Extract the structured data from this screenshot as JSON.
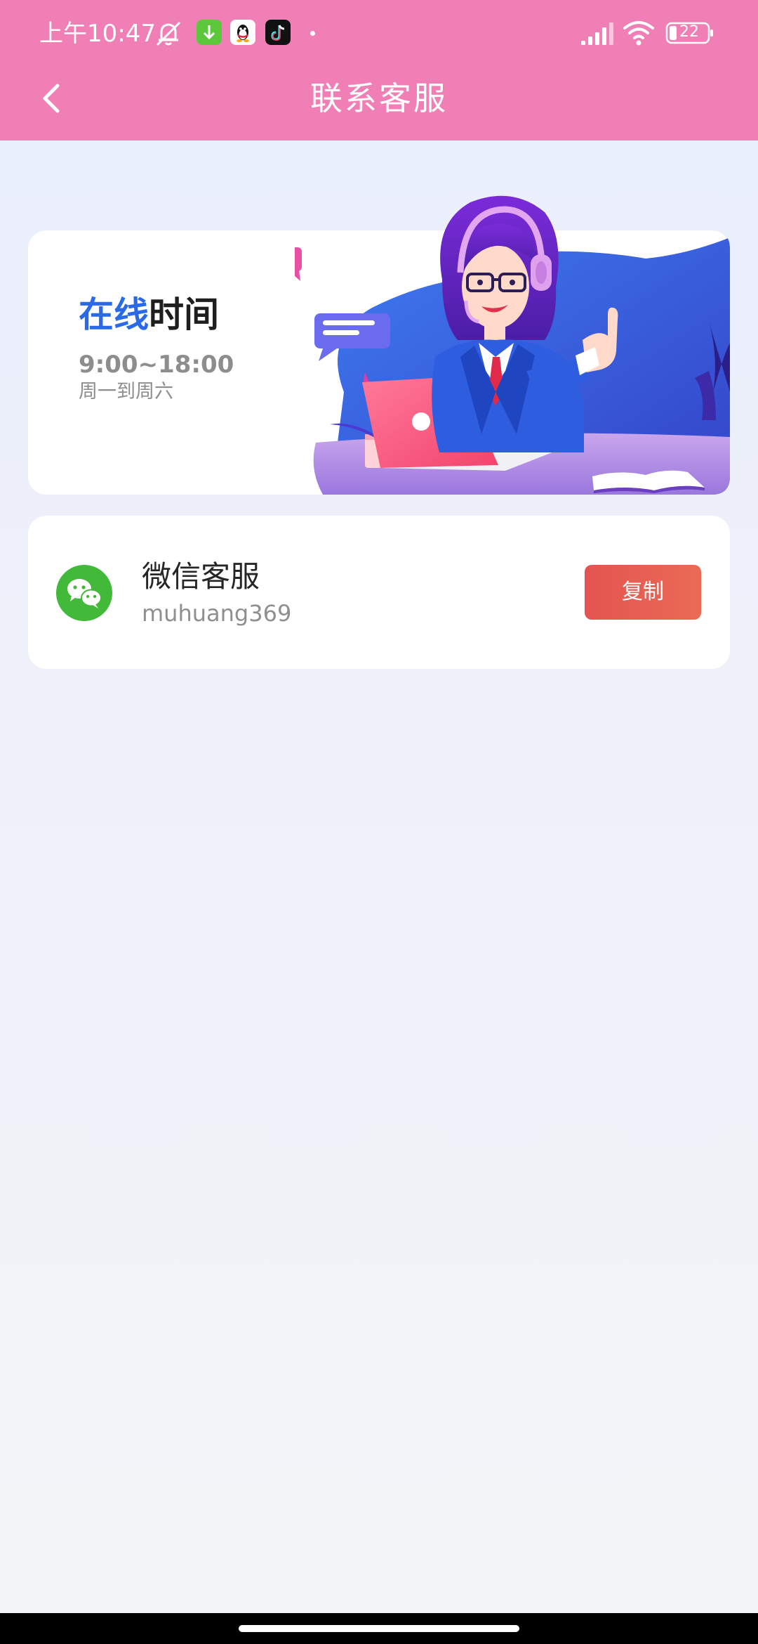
{
  "status_bar": {
    "time": "上午10:47",
    "battery": "22",
    "icons": [
      "mute-icon",
      "download-app-icon",
      "qq-app-icon",
      "tiktok-app-icon",
      "signal-icon",
      "wifi-icon",
      "battery-icon"
    ]
  },
  "header": {
    "title": "联系客服",
    "back_icon": "chevron-left-icon",
    "background_color": "#ef7fb5"
  },
  "banner": {
    "title_highlight": "在线",
    "title_rest": "时间",
    "hours": "9:00~18:00",
    "days": "周一到周六",
    "highlight_color": "#2a6ae6",
    "illustration": "customer-service-agent-illustration"
  },
  "contact": {
    "icon": "wechat-icon",
    "name": "微信客服",
    "account": "muhuang369",
    "copy_label": "复制",
    "button_color": "#e35451"
  }
}
